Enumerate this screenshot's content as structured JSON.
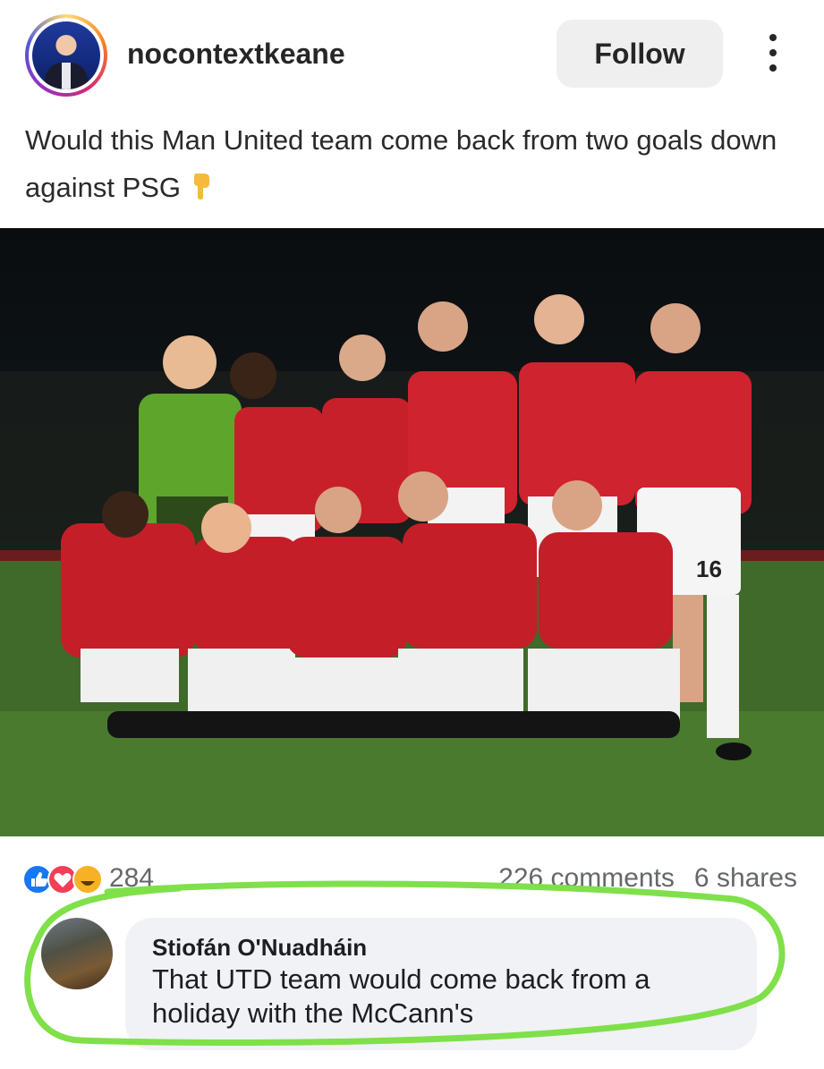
{
  "post": {
    "username": "nocontextkeane",
    "follow_label": "Follow",
    "caption": "Would this Man United team come back from two goals down against PSG",
    "caption_emoji": "pointing-down-emoji"
  },
  "photo": {
    "description_icon": "team-photo-image",
    "shirt_number": "16"
  },
  "reactions": {
    "count": "284",
    "comments": "226 comments",
    "shares": "6 shares",
    "icons": [
      "like-icon",
      "love-icon",
      "haha-icon"
    ]
  },
  "comment": {
    "author": "Stiofán O'Nuadháin",
    "text_line1": "That UTD team would come back from a",
    "text_line2": "holiday with the McCann's"
  },
  "colors": {
    "highlight_green": "#7fe04a",
    "like_blue": "#1877f2",
    "love_red": "#f33e58",
    "haha_yellow": "#f7b125"
  }
}
